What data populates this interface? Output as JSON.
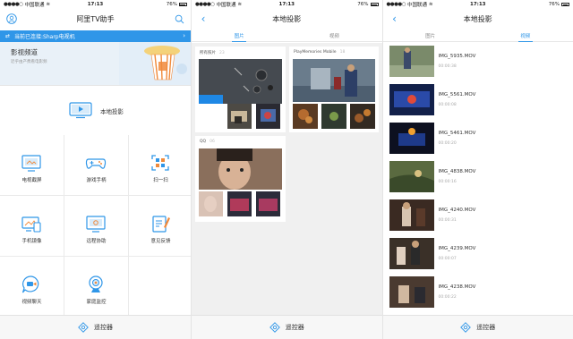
{
  "status_bar": {
    "carrier": "中国联通",
    "time": "17:13",
    "battery": "76%"
  },
  "screen1": {
    "title": "阿里TV助手",
    "banner_text": "当前已连接:Sharp电视机",
    "hero_title": "影视频道",
    "hero_subtitle": "近乎由产费看电影频",
    "cast_label": "本地投影",
    "grid_items": [
      {
        "label": "电视截屏",
        "icon": "screenshot-icon"
      },
      {
        "label": "游戏手柄",
        "icon": "gamepad-icon"
      },
      {
        "label": "扫一扫",
        "icon": "scan-icon"
      },
      {
        "label": "手机镜像",
        "icon": "mirror-icon"
      },
      {
        "label": "远程协助",
        "icon": "remote-assist-icon"
      },
      {
        "label": "意见反馈",
        "icon": "feedback-icon"
      },
      {
        "label": "视频聊天",
        "icon": "video-chat-icon"
      },
      {
        "label": "家庭监控",
        "icon": "camera-icon"
      }
    ],
    "bottom_label": "遥控器"
  },
  "screen2": {
    "title": "本地投影",
    "tabs": [
      "图片",
      "视频"
    ],
    "active_tab": 0,
    "albums": [
      {
        "name": "所有照片",
        "count": "23"
      },
      {
        "name": "PlayMemories Mobile",
        "count": "18"
      },
      {
        "name": "QQ",
        "count": "06"
      }
    ],
    "bottom_label": "遥控器"
  },
  "screen3": {
    "title": "本地投影",
    "tabs": [
      "图片",
      "视频"
    ],
    "active_tab": 1,
    "videos": [
      {
        "name": "IMG_5935.MOV",
        "duration": "00:00:38"
      },
      {
        "name": "IMG_5561.MOV",
        "duration": "00:00:08"
      },
      {
        "name": "IMG_5461.MOV",
        "duration": "00:00:20"
      },
      {
        "name": "IMG_4838.MOV",
        "duration": "00:00:16"
      },
      {
        "name": "IMG_4240.MOV",
        "duration": "00:00:31"
      },
      {
        "name": "IMG_4239.MOV",
        "duration": "00:00:07"
      },
      {
        "name": "IMG_4238.MOV",
        "duration": "00:00:22"
      }
    ],
    "bottom_label": "遥控器"
  },
  "colors": {
    "accent": "#2f96e8",
    "separator": "#e6e6e6",
    "background_gray": "#f0f0f0"
  }
}
